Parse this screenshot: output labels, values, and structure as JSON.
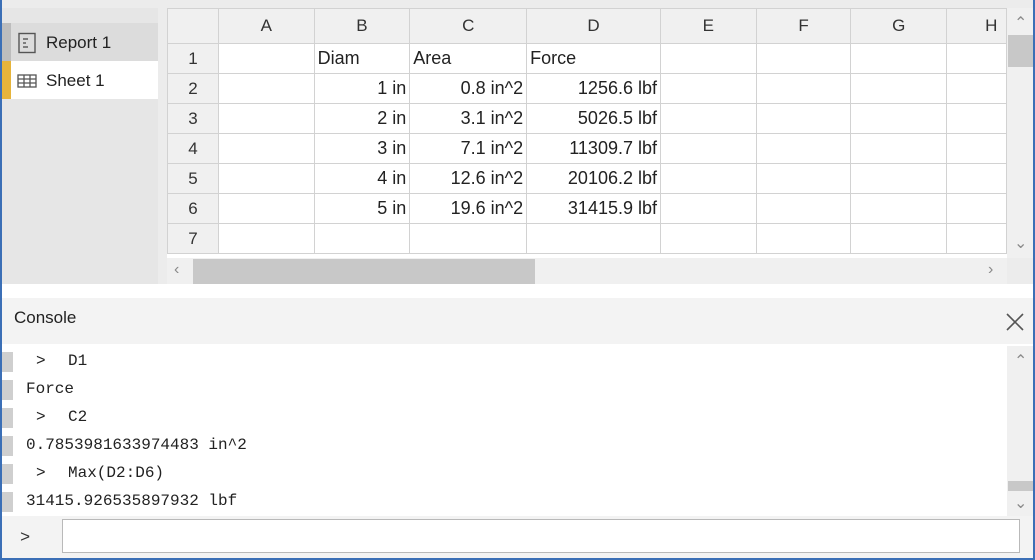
{
  "sidebar": {
    "items": [
      {
        "label": "Report 1",
        "icon": "report-icon"
      },
      {
        "label": "Sheet 1",
        "icon": "sheet-grid-icon",
        "accent": "#e6b43b"
      }
    ]
  },
  "sheet": {
    "columns": [
      "A",
      "B",
      "C",
      "D",
      "E",
      "F",
      "G",
      "H"
    ],
    "rows": [
      {
        "n": "1",
        "cells": [
          "",
          "Diam",
          "Area",
          "Force",
          "",
          "",
          "",
          ""
        ]
      },
      {
        "n": "2",
        "cells": [
          "",
          "1 in",
          "0.8 in^2",
          "1256.6 lbf",
          "",
          "",
          "",
          ""
        ]
      },
      {
        "n": "3",
        "cells": [
          "",
          "2 in",
          "3.1 in^2",
          "5026.5 lbf",
          "",
          "",
          "",
          ""
        ]
      },
      {
        "n": "4",
        "cells": [
          "",
          "3 in",
          "7.1 in^2",
          "11309.7 lbf",
          "",
          "",
          "",
          ""
        ]
      },
      {
        "n": "5",
        "cells": [
          "",
          "4 in",
          "12.6 in^2",
          "20106.2 lbf",
          "",
          "",
          "",
          ""
        ]
      },
      {
        "n": "6",
        "cells": [
          "",
          "5 in",
          "19.6 in^2",
          "31415.9 lbf",
          "",
          "",
          "",
          ""
        ]
      },
      {
        "n": "7",
        "cells": [
          "",
          "",
          "",
          "",
          "",
          "",
          "",
          ""
        ]
      }
    ]
  },
  "console": {
    "title": "Console",
    "prompt": ">",
    "input_value": "",
    "lines": [
      {
        "kind": "cmd",
        "text": "D1"
      },
      {
        "kind": "out",
        "text": "Force"
      },
      {
        "kind": "cmd",
        "text": "C2"
      },
      {
        "kind": "out",
        "text": "0.7853981633974483 in^2"
      },
      {
        "kind": "cmd",
        "text": "Max(D2:D6)"
      },
      {
        "kind": "out",
        "text": "31415.926535897932 lbf"
      }
    ]
  }
}
